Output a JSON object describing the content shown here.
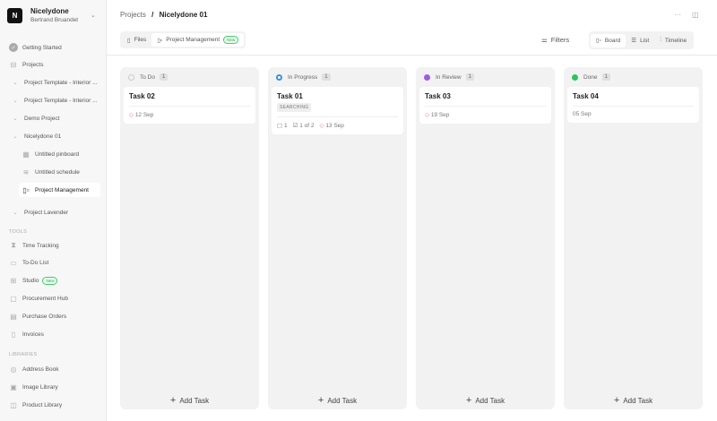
{
  "workspace": {
    "initial": "N",
    "name": "Nicelydone",
    "user": "Bertrand Bruandet"
  },
  "sidebar": {
    "main": [
      {
        "label": "Getting Started"
      },
      {
        "label": "Projects"
      }
    ],
    "projects": [
      {
        "label": "Project Template - Interior ..."
      },
      {
        "label": "Project Template - Interior ..."
      },
      {
        "label": "Demo Project"
      },
      {
        "label": "Nicelydone 01"
      }
    ],
    "sub": [
      {
        "label": "Untitled pinboard"
      },
      {
        "label": "Untitled schedule"
      },
      {
        "label": "Project Management"
      }
    ],
    "lavender": "Project Lavender",
    "tools_heading": "TOOLS",
    "tools": [
      {
        "label": "Time Tracking"
      },
      {
        "label": "To-Do List"
      },
      {
        "label": "Studio",
        "badge": "New"
      },
      {
        "label": "Procurement Hub"
      },
      {
        "label": "Purchase Orders"
      },
      {
        "label": "Invoices"
      }
    ],
    "libraries_heading": "LIBRARIES",
    "libraries": [
      {
        "label": "Address Book"
      },
      {
        "label": "Image Library"
      },
      {
        "label": "Product Library"
      }
    ]
  },
  "breadcrumb": {
    "root": "Projects",
    "sep": "/",
    "current": "Nicelydone 01"
  },
  "tabs": {
    "files": "Files",
    "pm": "Project Management",
    "pm_badge": "New"
  },
  "toolbar": {
    "filters": "Filters",
    "board": "Board",
    "list": "List",
    "timeline": "Timeline"
  },
  "columns": [
    {
      "title": "To Do",
      "count": "1",
      "color": "#cccccc",
      "add": "Add Task",
      "card": {
        "title": "Task 02",
        "date": "12 Sep"
      }
    },
    {
      "title": "In Progress",
      "count": "1",
      "color": "#3a8fd9",
      "add": "Add Task",
      "card": {
        "title": "Task 01",
        "tag": "SEARCHING",
        "comments": "1",
        "checklist": "1 of 2",
        "date": "13 Sep"
      }
    },
    {
      "title": "In Review",
      "count": "1",
      "color": "#9b5de5",
      "add": "Add Task",
      "card": {
        "title": "Task 03",
        "date": "19 Sep"
      }
    },
    {
      "title": "Done",
      "count": "1",
      "color": "#2ec45a",
      "add": "Add Task",
      "card": {
        "title": "Task 04",
        "date": "05 Sep"
      }
    }
  ]
}
